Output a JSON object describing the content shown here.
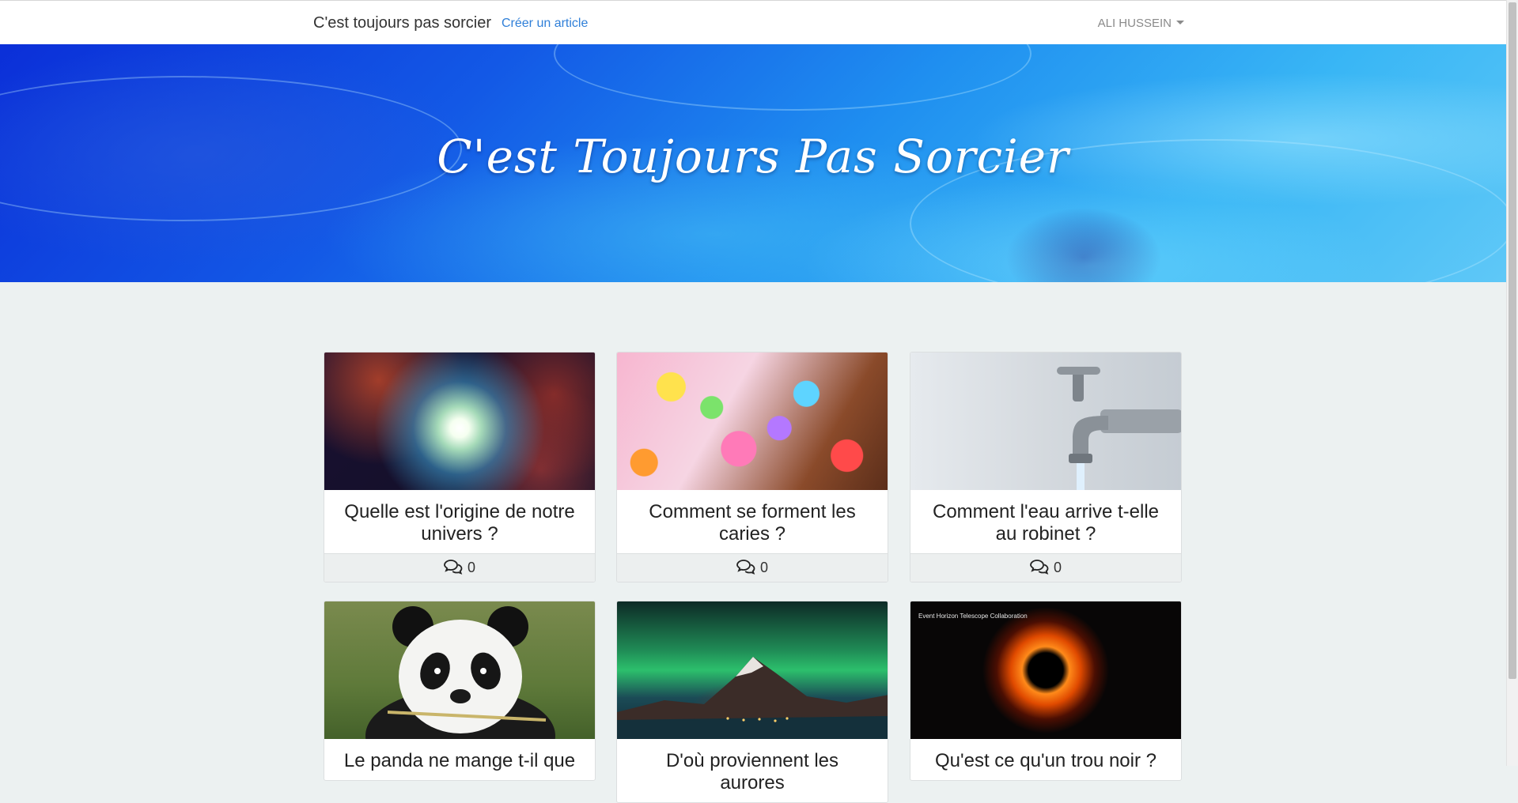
{
  "navbar": {
    "brand": "C'est toujours pas sorcier",
    "create_link": "Créer un article",
    "user": "ALI HUSSEIN"
  },
  "hero": {
    "title": "C'est Toujours Pas Sorcier"
  },
  "cards": [
    {
      "title": "Quelle est l'origine de notre univers ?",
      "comments": "0",
      "image": "universe-explosion"
    },
    {
      "title": "Comment se forment les caries ?",
      "comments": "0",
      "image": "candies"
    },
    {
      "title": "Comment l'eau arrive t-elle au robinet ?",
      "comments": "0",
      "image": "water-tap"
    },
    {
      "title": "Le panda ne mange t-il que",
      "comments": "",
      "image": "panda"
    },
    {
      "title": "D'où proviennent les aurores",
      "comments": "",
      "image": "aurora"
    },
    {
      "title": "Qu'est ce qu'un trou noir ?",
      "comments": "",
      "image": "black-hole",
      "image_caption": "Event Horizon Telescope Collaboration"
    }
  ],
  "colors": {
    "link": "#2f7fd8",
    "background": "#ecf1f1",
    "hero_blue": "#1f8ff0"
  }
}
